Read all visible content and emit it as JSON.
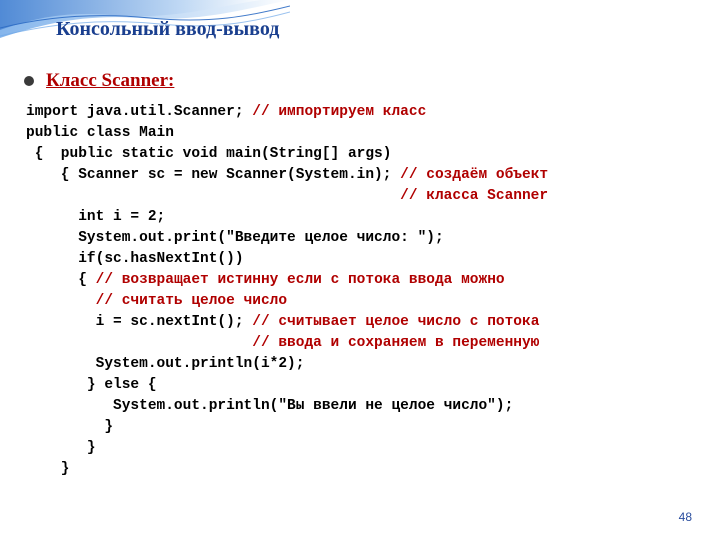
{
  "title": "Консольный ввод-вывод",
  "bullet": "Класс Scanner:",
  "page_number": "48",
  "code": {
    "l1a": "import java.util.Scanner; ",
    "l1c": "// импортируем класс",
    "l2": "public class Main",
    "l3": " {  public static void main(String[] args)",
    "l4a": "    { Scanner sc = new Scanner(System.in); ",
    "l4c": "// создаём объект",
    "l5c": "                                           // класса Scanner",
    "l6": "      int i = 2;",
    "l7": "      System.out.print(\"Введите целое число: \");",
    "l8": "      if(sc.hasNextInt())",
    "l9a": "      { ",
    "l9c": "// возвращает истинну если с потока ввода можно",
    "l10c": "        // считать целое число",
    "l11a": "        i = sc.nextInt(); ",
    "l11c": "// считывает целое число с потока",
    "l12c": "                          // ввода и сохраняем в переменную",
    "l13": "        System.out.println(i*2);",
    "l14": "       } else {",
    "l15": "          System.out.println(\"Вы ввели не целое число\");",
    "l16": "         }",
    "l17": "       }",
    "l18": "    }"
  }
}
